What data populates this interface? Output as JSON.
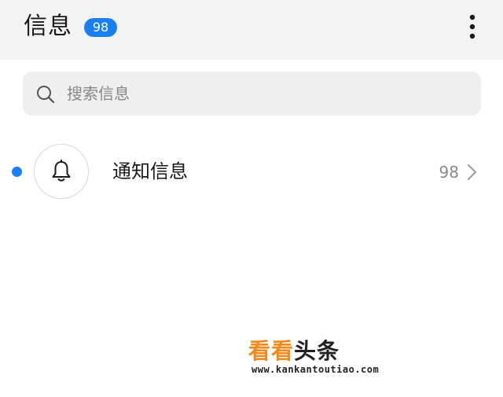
{
  "header": {
    "title": "信息",
    "badge_count": "98",
    "menu_icon": "more-vertical-icon"
  },
  "search": {
    "placeholder": "搜索信息",
    "icon": "search-icon"
  },
  "conversations": [
    {
      "title": "通知信息",
      "count": "98",
      "unread": true,
      "icon": "bell-icon"
    }
  ],
  "watermark": {
    "logo_part1": "看看",
    "logo_part2": "头条",
    "url": "www.kankantoutiao.com"
  },
  "colors": {
    "accent": "#1a7ff2",
    "header_bg": "#f3f3f3",
    "search_bg": "#efefef",
    "watermark_orange": "#f08a1c"
  }
}
